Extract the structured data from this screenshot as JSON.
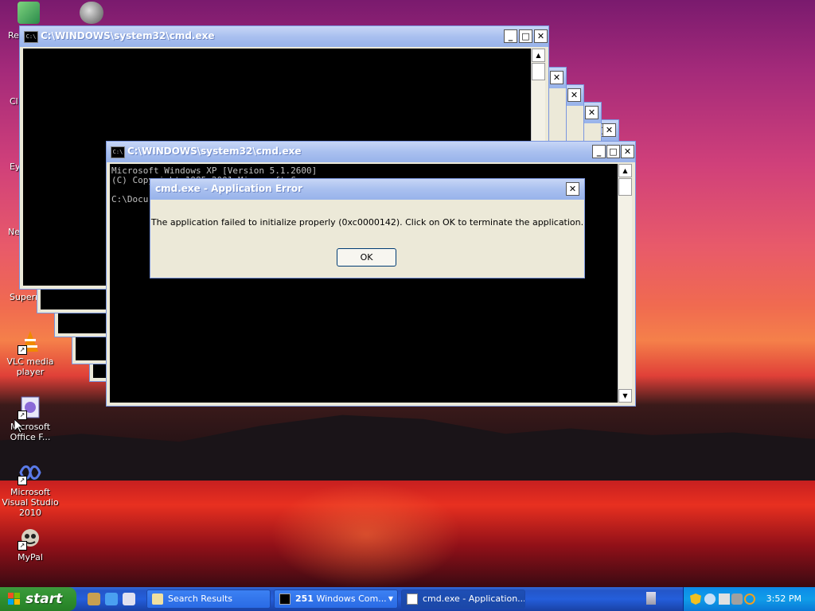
{
  "desktop": {
    "icons": [
      {
        "label": "VLC media player",
        "icon": "vlc-icon"
      },
      {
        "label": "Microsoft Office F...",
        "icon": "office-icon"
      },
      {
        "label": "Microsoft Visual Studio 2010",
        "icon": "visual-studio-icon"
      },
      {
        "label": "MyPal",
        "icon": "mypal-icon"
      }
    ],
    "partial_labels": [
      "Re",
      "Cl",
      "Ey",
      "Ne",
      "Superr"
    ]
  },
  "back_window": {
    "title": "C:\\WINDOWS\\system32\\cmd.exe"
  },
  "front_window": {
    "title": "C:\\WINDOWS\\system32\\cmd.exe",
    "line1": "Microsoft Windows XP [Version 5.1.2600]",
    "line2": "(C) Copyright 1985-2001 Microsoft Corp.",
    "line3": "C:\\Docu"
  },
  "dialog": {
    "title": "cmd.exe - Application Error",
    "message": "The application failed to initialize properly (0xc0000142). Click on OK to terminate the application.",
    "ok_label": "OK"
  },
  "taskbar": {
    "start_label": "start",
    "buttons": [
      {
        "label": "Search Results",
        "icon": "folder-search-icon"
      },
      {
        "label": "Windows Com...",
        "count": "251",
        "icon": "cmd-icon"
      },
      {
        "label": "cmd.exe - Application...",
        "icon": "window-icon"
      }
    ],
    "clock": "3:52 PM"
  },
  "colors": {
    "titlebar_inactive": "#98b3ea",
    "taskbar": "#245edb",
    "start": "#2f8f2f"
  }
}
